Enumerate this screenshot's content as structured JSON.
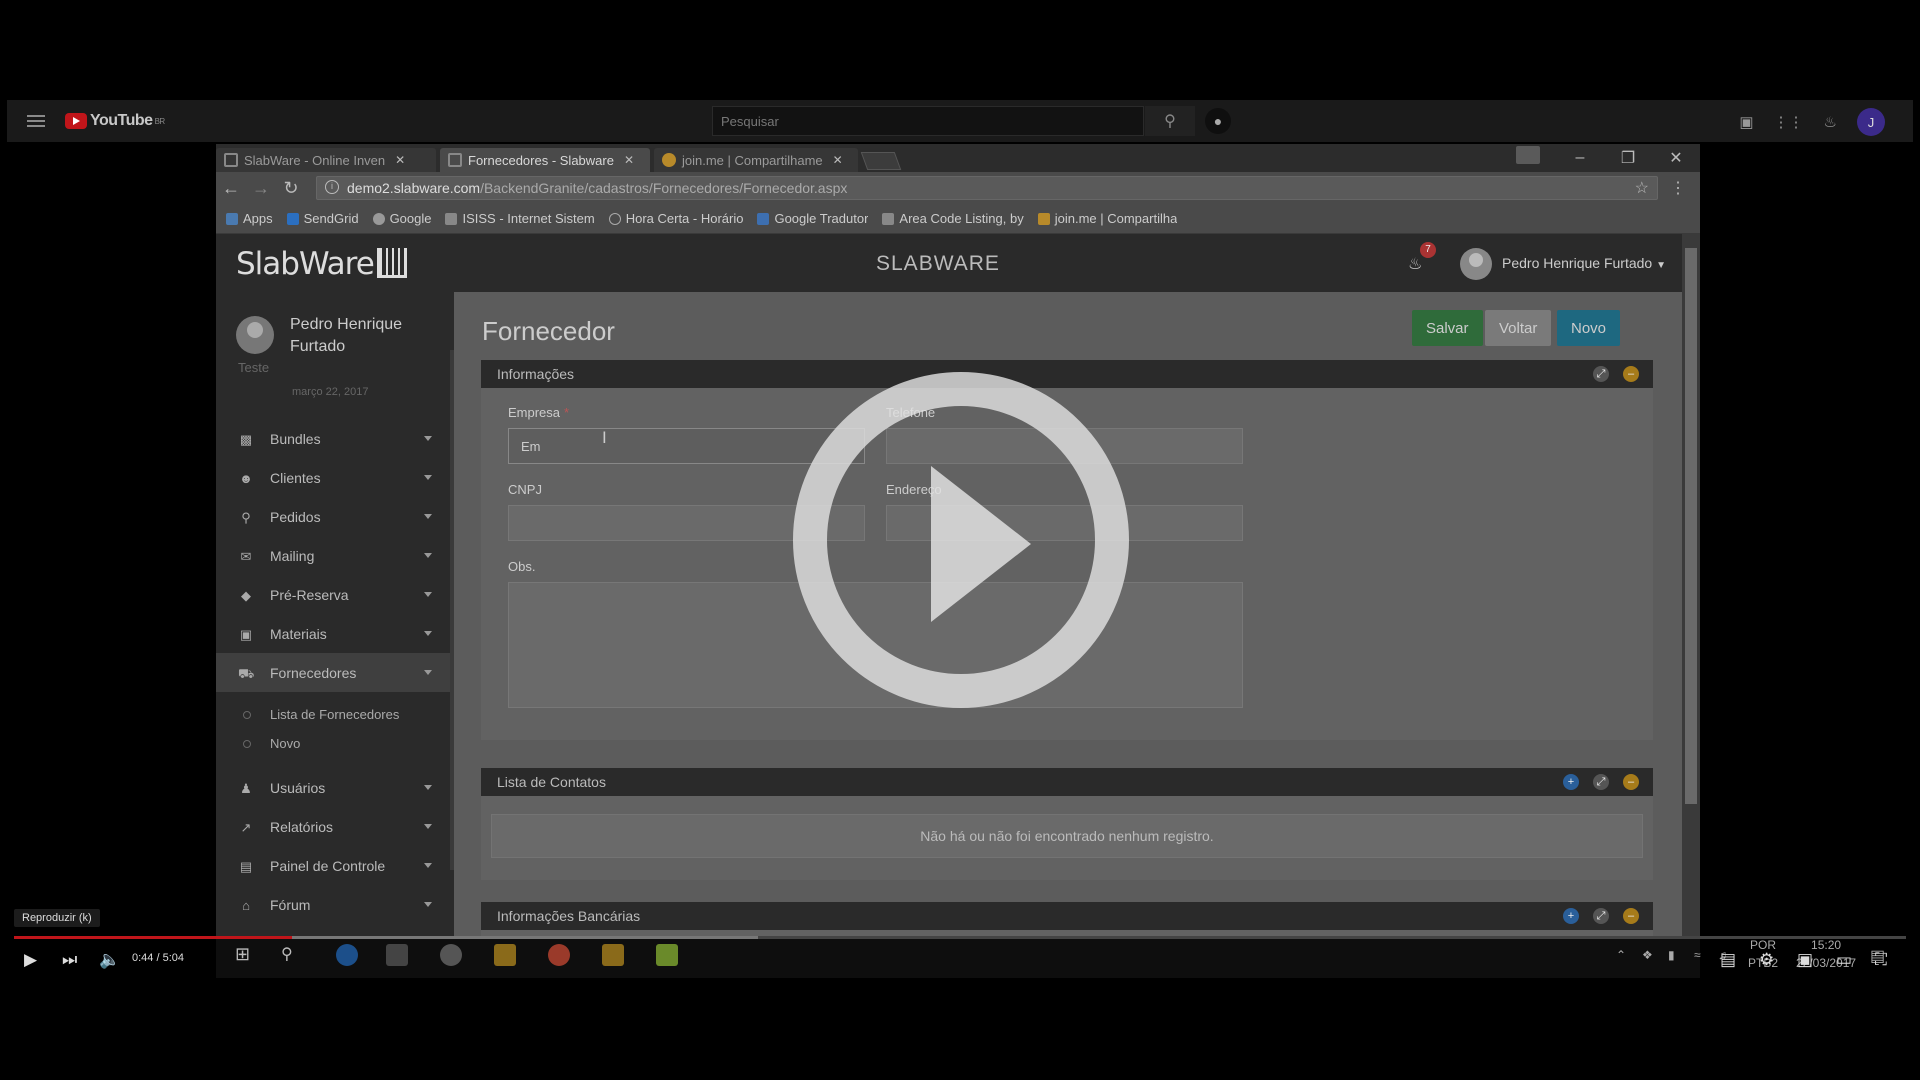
{
  "youtube": {
    "logo_text": "YouTube",
    "region": "BR",
    "search_placeholder": "Pesquisar",
    "avatar_letter": "J"
  },
  "browser": {
    "tabs": [
      {
        "label": "SlabWare - Online Inven",
        "active": false
      },
      {
        "label": "Fornecedores - Slabware",
        "active": true
      },
      {
        "label": "join.me | Compartilhame",
        "active": false
      }
    ],
    "url_host": "demo2.slabware.com",
    "url_path": "/BackendGranite/cadastros/Fornecedores/Fornecedor.aspx",
    "bookmarks": [
      "Apps",
      "SendGrid",
      "Google",
      "ISISS - Internet Sistem",
      "Hora Certa - Horário",
      "Google Tradutor",
      "Area Code Listing, by",
      "join.me | Compartilha"
    ]
  },
  "app": {
    "brand": "SLABWARE",
    "notifications_count": "7",
    "user_name": "Pedro Henrique Furtado",
    "sidebar": {
      "user_name": "Pedro Henrique Furtado",
      "role": "Teste",
      "date": "março 22, 2017",
      "items": [
        {
          "label": "Bundles",
          "icon": "cubes-icon"
        },
        {
          "label": "Clientes",
          "icon": "users-icon"
        },
        {
          "label": "Pedidos",
          "icon": "cart-icon"
        },
        {
          "label": "Mailing",
          "icon": "envelope-icon"
        },
        {
          "label": "Pré-Reserva",
          "icon": "tags-icon"
        },
        {
          "label": "Materiais",
          "icon": "cube-icon"
        },
        {
          "label": "Fornecedores",
          "icon": "truck-icon",
          "active": true
        },
        {
          "label": "Usuários",
          "icon": "user-icon"
        },
        {
          "label": "Relatórios",
          "icon": "chart-icon"
        },
        {
          "label": "Painel de Controle",
          "icon": "laptop-icon"
        },
        {
          "label": "Fórum",
          "icon": "bank-icon"
        }
      ],
      "subitems": [
        "Lista de Fornecedores",
        "Novo"
      ]
    },
    "page_title": "Fornecedor",
    "buttons": {
      "save": "Salvar",
      "back": "Voltar",
      "new": "Novo"
    },
    "panel_info": {
      "title": "Informações",
      "empresa_label": "Empresa",
      "empresa_required": "*",
      "empresa_value": "Em",
      "telefone_label": "Telefone",
      "cnpj_label": "CNPJ",
      "endereco_label": "Endereço",
      "obs_label": "Obs."
    },
    "panel_contatos": {
      "title": "Lista de Contatos",
      "empty_message": "Não há ou não foi encontrado nenhum registro."
    },
    "panel_bank": {
      "title": "Informações Bancárias"
    }
  },
  "windows_tray": {
    "lang_top": "POR",
    "lang_bottom": "PTB2",
    "time": "15:20",
    "date": "22/03/2017"
  },
  "player": {
    "tooltip": "Reproduzir (k)",
    "time": "0:44 / 5:04",
    "progress_fraction": 0.147
  }
}
